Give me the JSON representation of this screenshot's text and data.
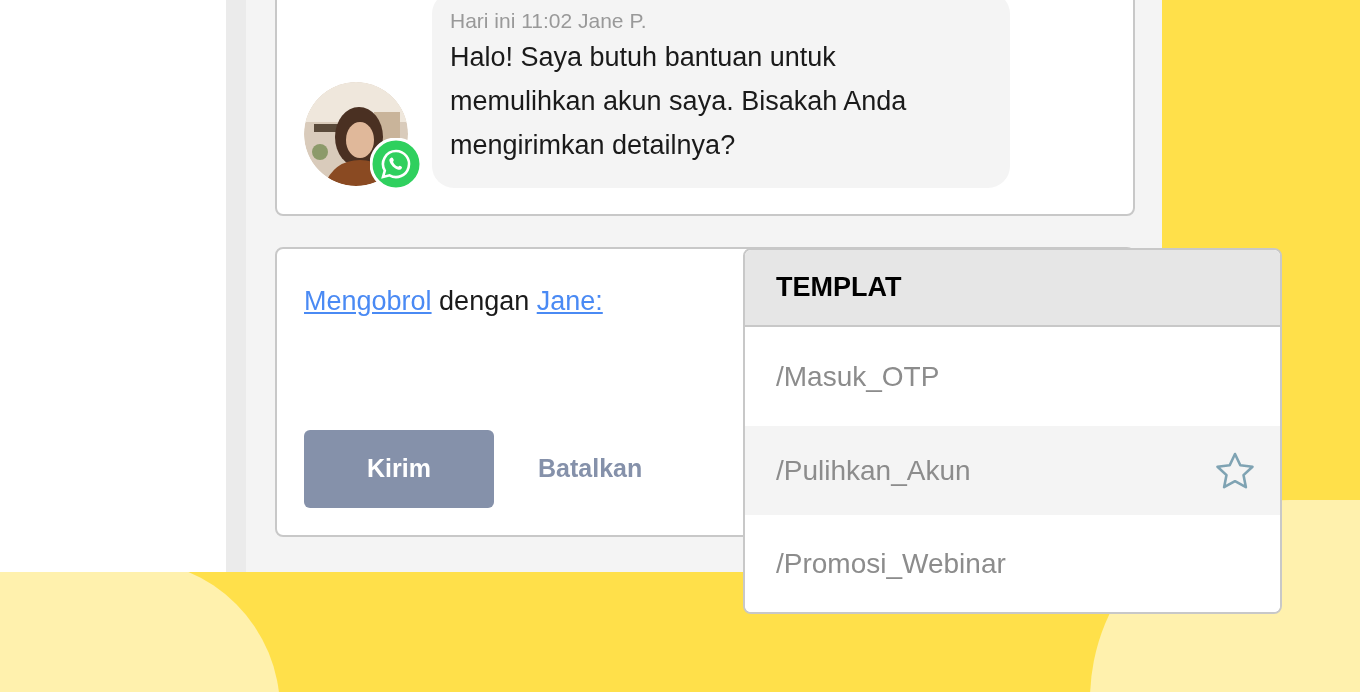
{
  "message": {
    "meta": "Hari ini 11:02 Jane P.",
    "text": "Halo! Saya butuh bantuan untuk memulihkan akun saya. Bisakah Anda mengirimkan detailnya?"
  },
  "compose": {
    "prompt": [
      {
        "kind": "link",
        "text": "Mengobrol"
      },
      {
        "kind": "text",
        "text": "dengan"
      },
      {
        "kind": "link",
        "text": "Jane:"
      }
    ],
    "buttons": [
      {
        "kind": "primary",
        "label": "Kirim"
      },
      {
        "kind": "secondary",
        "label": "Batalkan"
      }
    ]
  },
  "templates": {
    "title": "TEMPLAT",
    "items": [
      {
        "label": "/Masuk_OTP",
        "selected": false
      },
      {
        "label": "/Pulihkan_Akun",
        "selected": true
      },
      {
        "label": "/Promosi_Webinar",
        "selected": false
      }
    ]
  }
}
